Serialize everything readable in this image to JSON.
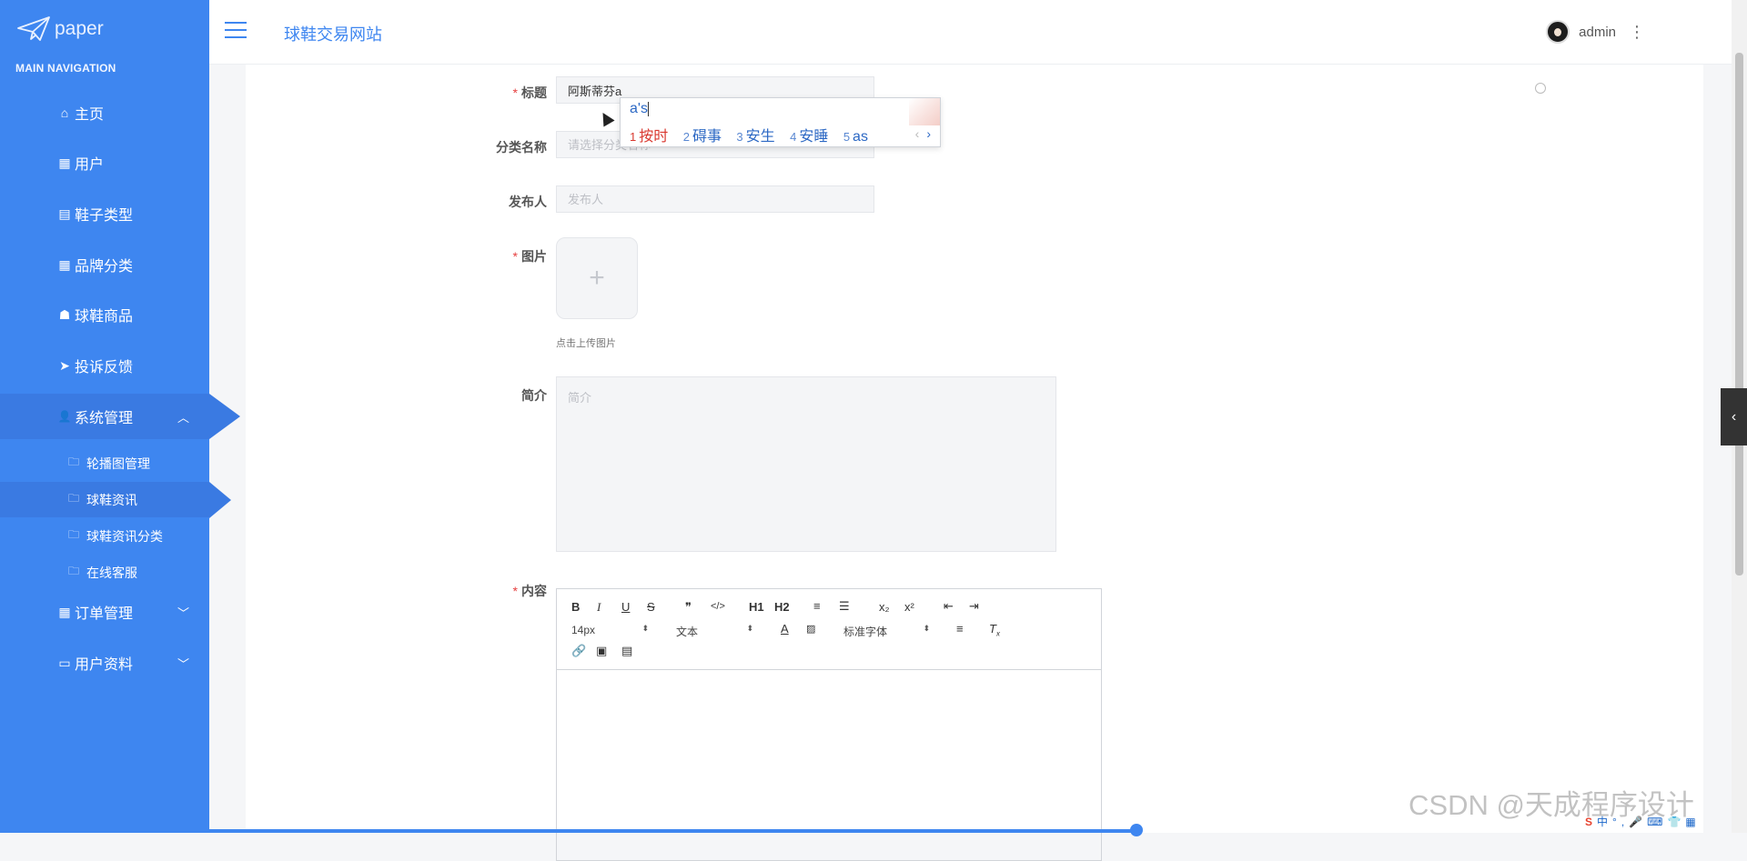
{
  "brand": {
    "name": "paper"
  },
  "sidebar": {
    "heading": "MAIN NAVIGATION",
    "items": [
      {
        "label": "主页",
        "icon": "⌂"
      },
      {
        "label": "用户",
        "icon": "▦"
      },
      {
        "label": "鞋子类型",
        "icon": "▤"
      },
      {
        "label": "品牌分类",
        "icon": "▦"
      },
      {
        "label": "球鞋商品",
        "icon": "☗"
      },
      {
        "label": "投诉反馈",
        "icon": "➤"
      },
      {
        "label": "系统管理",
        "icon": "👤",
        "expanded": true
      },
      {
        "label": "订单管理",
        "icon": "▦"
      },
      {
        "label": "用户资料",
        "icon": "▭"
      }
    ],
    "subitems": [
      {
        "label": "轮播图管理"
      },
      {
        "label": "球鞋资讯",
        "active": true
      },
      {
        "label": "球鞋资讯分类"
      },
      {
        "label": "在线客服"
      }
    ]
  },
  "header": {
    "site_title": "球鞋交易网站",
    "username": "admin"
  },
  "form": {
    "title_label": "标题",
    "title_value": "阿斯蒂芬a",
    "category_label": "分类名称",
    "category_placeholder": "请选择分类名称",
    "publisher_label": "发布人",
    "publisher_placeholder": "发布人",
    "image_label": "图片",
    "upload_tip": "点击上传图片",
    "intro_label": "简介",
    "intro_placeholder": "简介",
    "content_label": "内容"
  },
  "editor": {
    "toolbar_row1": [
      "B",
      "I",
      "U",
      "S",
      "❞",
      "</>",
      "H1",
      "H2",
      "≡",
      "☰",
      "x₂",
      "x²",
      "⇤",
      "⇥"
    ],
    "font_size": "14px",
    "block_format": "文本",
    "font_family": "标准字体",
    "toolbar_row3_icons": [
      "link-icon",
      "image-icon",
      "video-icon"
    ]
  },
  "ime": {
    "composition": "a's",
    "candidates": [
      {
        "n": "1",
        "text": "按时"
      },
      {
        "n": "2",
        "text": "碍事"
      },
      {
        "n": "3",
        "text": "安生"
      },
      {
        "n": "4",
        "text": "安睡"
      },
      {
        "n": "5",
        "text": "as"
      }
    ]
  },
  "watermark": "CSDN @天成程序设计",
  "colors": {
    "sidebar": "#3e86f0",
    "accent": "#3e86f0",
    "required": "#e64040"
  }
}
